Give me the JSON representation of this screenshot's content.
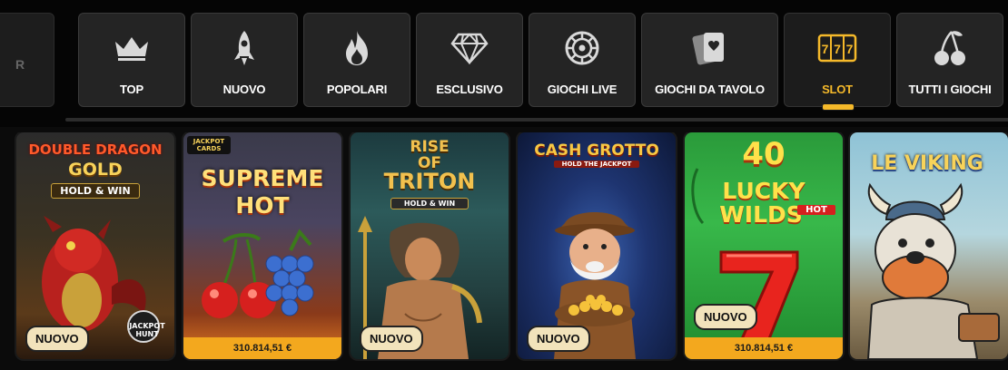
{
  "categories": [
    {
      "label": "",
      "icon": "stub",
      "active": false,
      "stub_text": "R"
    },
    {
      "label": "TOP",
      "icon": "crown-icon",
      "active": false
    },
    {
      "label": "NUOVO",
      "icon": "rocket-icon",
      "active": false
    },
    {
      "label": "POPOLARI",
      "icon": "flame-icon",
      "active": false
    },
    {
      "label": "ESCLUSIVO",
      "icon": "diamond-icon",
      "active": false
    },
    {
      "label": "GIOCHI LIVE",
      "icon": "roulette-icon",
      "active": false
    },
    {
      "label": "GIOCHI DA TAVOLO",
      "icon": "cards-icon",
      "active": false
    },
    {
      "label": "SLOT",
      "icon": "slot-777-icon",
      "active": true
    },
    {
      "label": "TUTTI I GIOCHI",
      "icon": "cherries-icon",
      "active": false
    }
  ],
  "games": [
    {
      "title_lines": [
        "DOUBLE DRAGON",
        "GOLD",
        "HOLD & WIN"
      ],
      "badge": "NUOVO",
      "extra_logo": "JACKPOT HUNT",
      "jackpot": ""
    },
    {
      "title_lines": [
        "SUPREME",
        "HOT"
      ],
      "top_logo": "JACKPOT CARDS",
      "badge": "",
      "jackpot": "310.814,51 €"
    },
    {
      "title_lines": [
        "RISE",
        "OF",
        "TRITON",
        "HOLD & WIN"
      ],
      "badge": "NUOVO",
      "jackpot": ""
    },
    {
      "title_lines": [
        "CASH GROTTO",
        "HOLD THE JACKPOT"
      ],
      "badge": "NUOVO",
      "jackpot": ""
    },
    {
      "title_lines": [
        "40",
        "LUCKY",
        "WILDS",
        "HOT"
      ],
      "badge": "NUOVO",
      "jackpot": "310.814,51 €"
    },
    {
      "title_lines": [
        "LE VIKING"
      ],
      "badge": "",
      "jackpot": ""
    }
  ],
  "colors": {
    "accent": "#f5b92a",
    "tile_bg": "#242424",
    "jackpot_bar": "#f3a81e"
  }
}
